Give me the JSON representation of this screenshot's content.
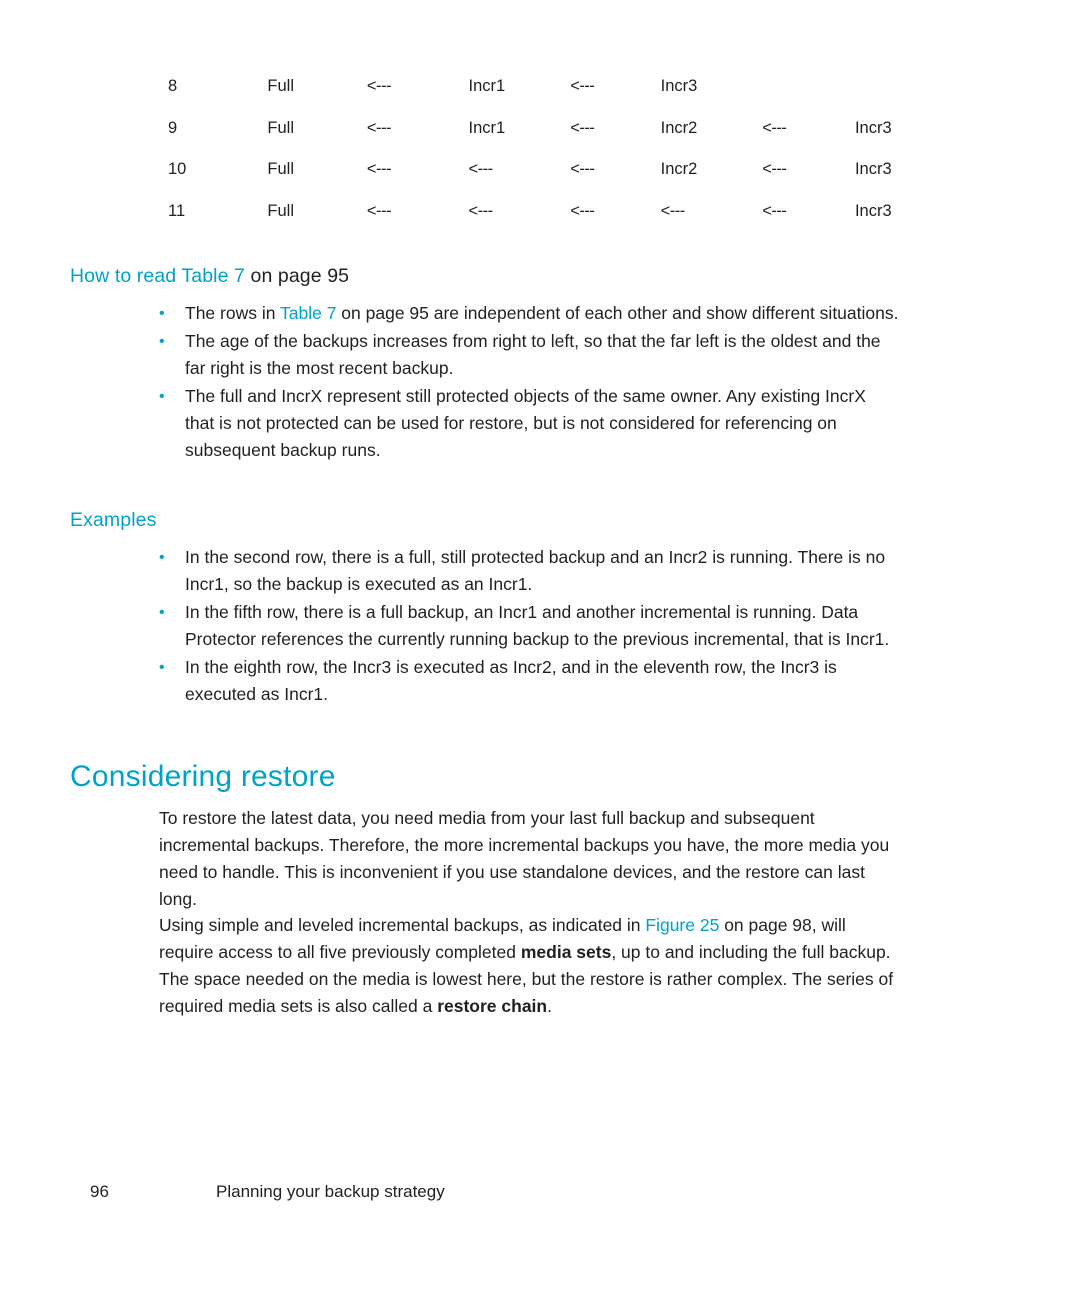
{
  "table": {
    "rows": [
      [
        "8",
        "Full",
        "<---",
        "Incr1",
        "<---",
        "Incr3",
        "",
        ""
      ],
      [
        "9",
        "Full",
        "<---",
        "Incr1",
        "<---",
        "Incr2",
        "<---",
        "Incr3"
      ],
      [
        "10",
        "Full",
        "<---",
        "<---",
        "<---",
        "Incr2",
        "<---",
        "Incr3"
      ],
      [
        "11",
        "Full",
        "<---",
        "<---",
        "<---",
        "<---",
        "<---",
        "Incr3"
      ]
    ]
  },
  "how_to_read": {
    "heading_prefix": "How to read Table 7",
    "heading_suffix": " on page 95",
    "bullets": [
      {
        "pre": "The rows in ",
        "link": "Table 7",
        "post": " on page 95 are independent of each other and show different situations."
      },
      {
        "pre": "",
        "link": "",
        "post": "The age of the backups increases from right to left, so that the far left is the oldest and the far right is the most recent backup."
      },
      {
        "pre": "",
        "link": "",
        "post": "The full and IncrX represent still protected objects of the same owner. Any existing IncrX that is not protected can be used for restore, but is not considered for referencing on subsequent backup runs."
      }
    ]
  },
  "examples": {
    "heading": "Examples",
    "bullets": [
      "In the second row, there is a full, still protected backup and an Incr2 is running. There is no Incr1, so the backup is executed as an Incr1.",
      "In the fifth row, there is a full backup, an Incr1 and another incremental is running. Data Protector references the currently running backup to the previous incremental, that is Incr1.",
      "In the eighth row, the Incr3 is executed as Incr2, and in the eleventh row, the Incr3 is executed as Incr1."
    ]
  },
  "considering_restore": {
    "heading": "Considering restore",
    "paragraph1": "To restore the latest data, you need media from your last full backup and subsequent incremental backups. Therefore, the more incremental backups you have, the more media you need to handle. This is inconvenient if you use standalone devices, and the restore can last long.",
    "paragraph2": {
      "p1": "Using simple and leveled incremental backups, as indicated in ",
      "link": "Figure 25",
      "p2": " on page 98, will require access to all five previously completed ",
      "bold1": "media sets",
      "p3": ", up to and including the full backup. The space needed on the media is lowest here, but the restore is rather complex. The series of required media sets is also called a ",
      "bold2": "restore chain",
      "p4": "."
    }
  },
  "footer": {
    "page_number": "96",
    "section_title": "Planning your backup strategy"
  },
  "colors": {
    "accent": "#00a3c7",
    "text": "#231f20"
  }
}
